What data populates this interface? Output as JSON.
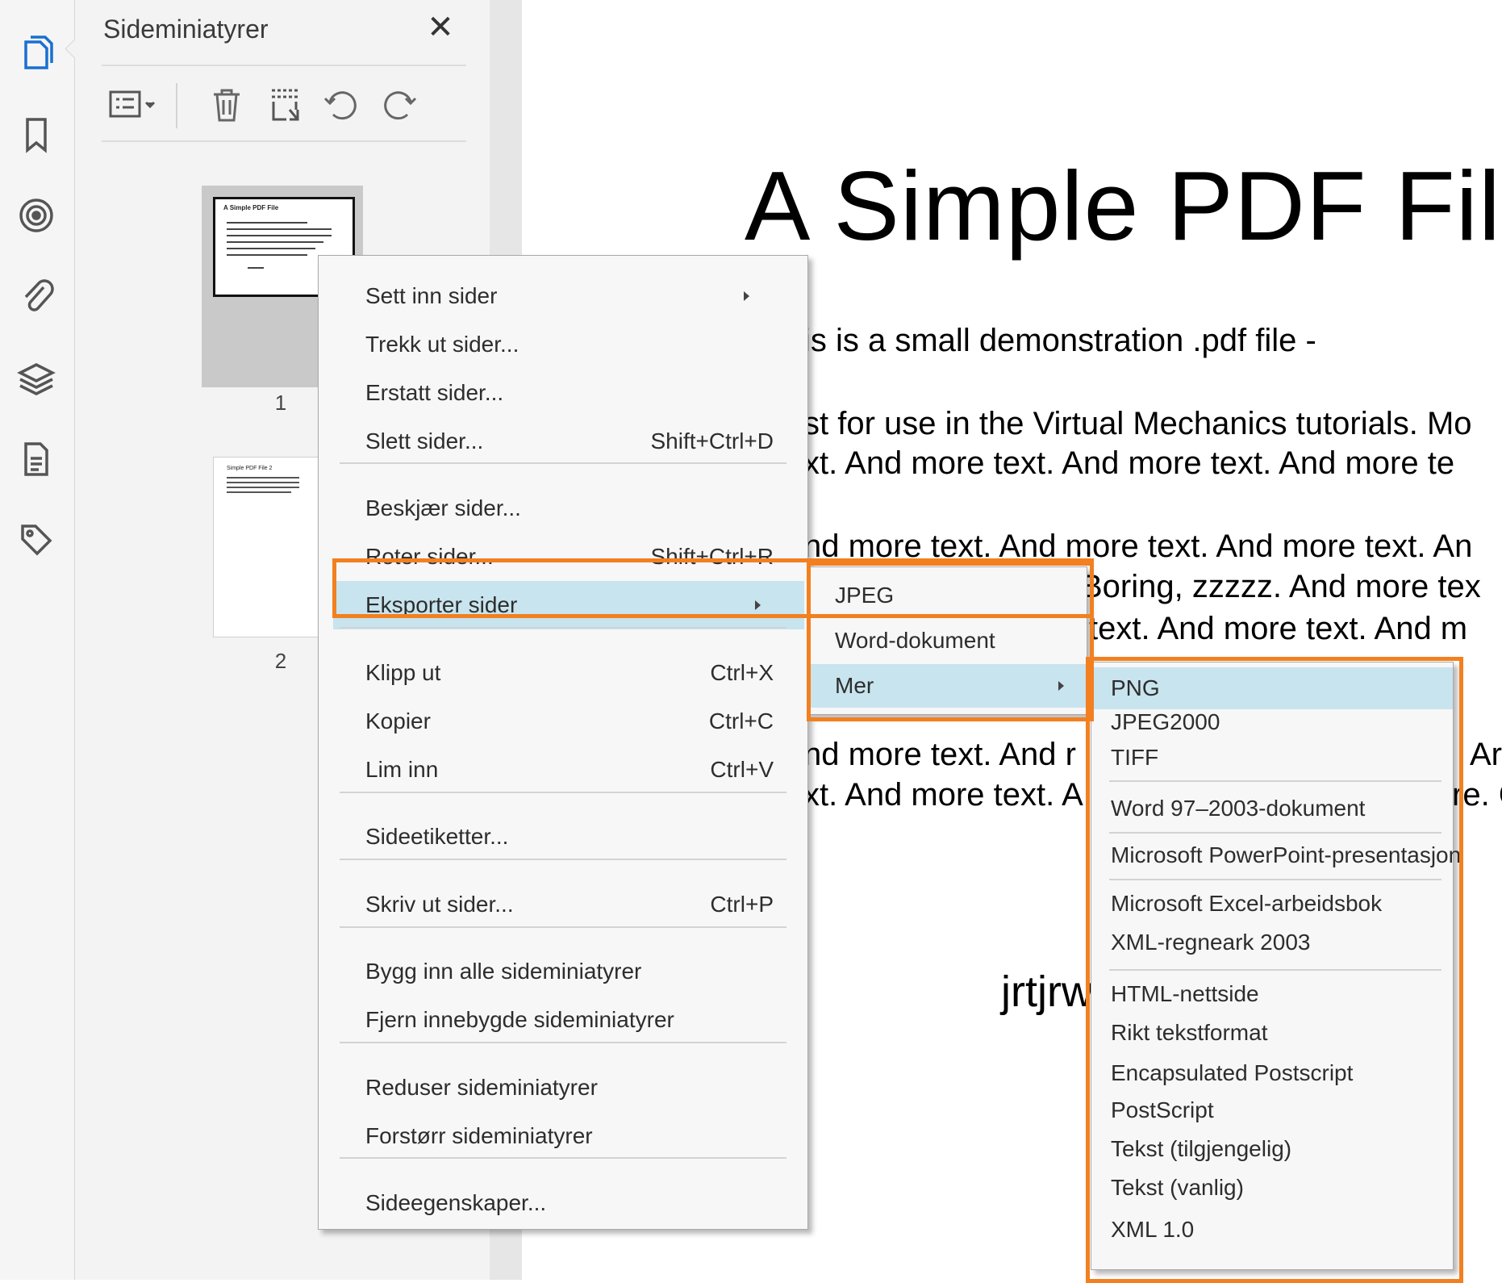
{
  "panel": {
    "title": "Sideminiatyrer",
    "close": "✕",
    "thumbnails": [
      {
        "label": "1",
        "header": "A Simple PDF File"
      },
      {
        "label": "2",
        "header": "Simple PDF File 2"
      }
    ]
  },
  "document": {
    "title": "A Simple PDF File",
    "lines": [
      "is is a small demonstration .pdf file -",
      "st for use in the Virtual Mechanics tutorials. Mo",
      "xt. And more text. And more text. And more te",
      "nd more text. And more text. And more text. An",
      "Boring, zzzzz. And more tex",
      "text. And more text. And m",
      "nd more text. And r",
      "xt. And more text. A"
    ],
    "right_fragments": [
      "Ar",
      "re. C"
    ],
    "signature": "jrtjrw"
  },
  "context_menu": {
    "items": [
      {
        "label": "Sett inn sider",
        "submenu": true
      },
      {
        "label": "Trekk ut sider..."
      },
      {
        "label": "Erstatt sider..."
      },
      {
        "label": "Slett sider...",
        "shortcut": "Shift+Ctrl+D"
      },
      {
        "label": "Beskjær sider..."
      },
      {
        "label": "Roter sider...",
        "shortcut": "Shift+Ctrl+R"
      },
      {
        "label": "Eksporter sider",
        "submenu": true,
        "highlighted": true
      },
      {
        "label": "Klipp ut",
        "shortcut": "Ctrl+X"
      },
      {
        "label": "Kopier",
        "shortcut": "Ctrl+C"
      },
      {
        "label": "Lim inn",
        "shortcut": "Ctrl+V"
      },
      {
        "label": "Sideetiketter..."
      },
      {
        "label": "Skriv ut sider...",
        "shortcut": "Ctrl+P"
      },
      {
        "label": "Bygg inn alle sideminiatyrer"
      },
      {
        "label": "Fjern innebygde sideminiatyrer"
      },
      {
        "label": "Reduser sideminiatyrer"
      },
      {
        "label": "Forstørr sideminiatyrer"
      },
      {
        "label": "Sideegenskaper..."
      }
    ]
  },
  "export_submenu": {
    "items": [
      {
        "label": "JPEG"
      },
      {
        "label": "Word-dokument"
      },
      {
        "label": "Mer",
        "submenu": true,
        "highlighted": true
      }
    ]
  },
  "more_submenu": {
    "items": [
      {
        "label": "PNG",
        "highlighted": true
      },
      {
        "label": "JPEG2000"
      },
      {
        "label": "TIFF"
      },
      {
        "label": "Word 97–2003-dokument"
      },
      {
        "label": "Microsoft PowerPoint-presentasjon"
      },
      {
        "label": "Microsoft Excel-arbeidsbok"
      },
      {
        "label": "XML-regneark 2003"
      },
      {
        "label": "HTML-nettside"
      },
      {
        "label": "Rikt tekstformat"
      },
      {
        "label": "Encapsulated Postscript"
      },
      {
        "label": "PostScript"
      },
      {
        "label": "Tekst (tilgjengelig)"
      },
      {
        "label": "Tekst (vanlig)"
      },
      {
        "label": "XML 1.0"
      }
    ]
  },
  "colors": {
    "callout": "#f28020",
    "highlight": "#c8e4ee",
    "active_rail_icon": "#1a6fd1"
  }
}
